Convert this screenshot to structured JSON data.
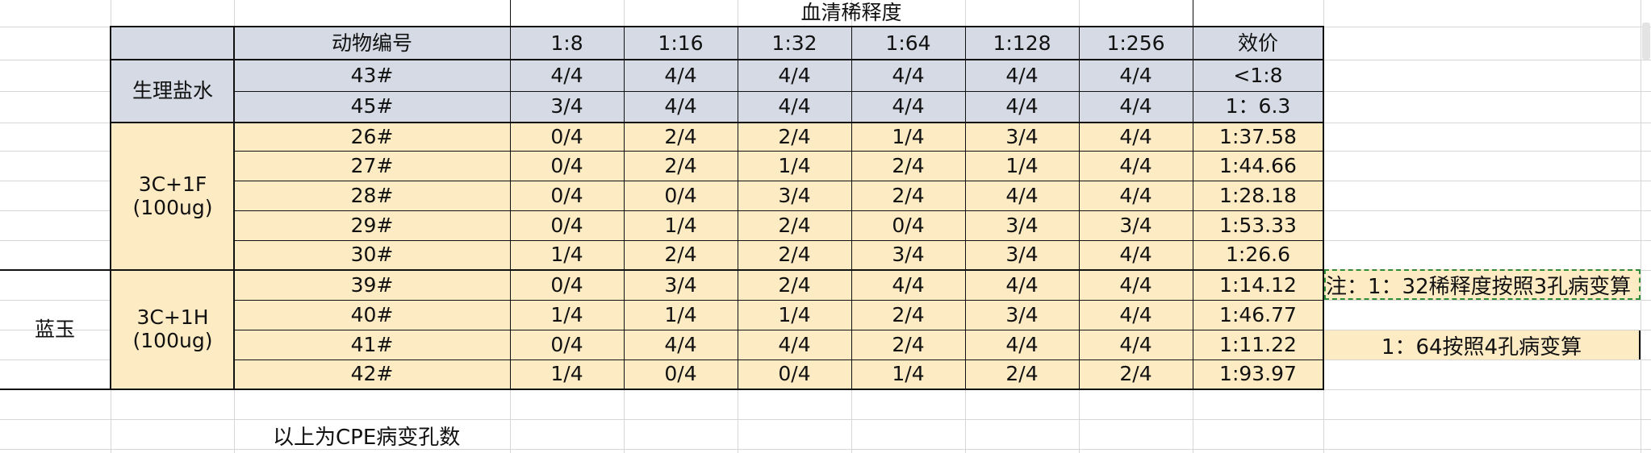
{
  "sheet": {
    "title_dilution": "血清稀释度",
    "headers": [
      "动物编号",
      "1:8",
      "1:16",
      "1:32",
      "1:64",
      "1:128",
      "1:256",
      "效价"
    ],
    "groups": [
      "生理盐水",
      "3C+1F",
      "(100ug)",
      "3C+1H",
      "(100ug)"
    ],
    "outer_label": "蓝玉",
    "rows": [
      [
        "43#",
        "4/4",
        "4/4",
        "4/4",
        "4/4",
        "4/4",
        "4/4",
        "<1:8"
      ],
      [
        "45#",
        "3/4",
        "4/4",
        "4/4",
        "4/4",
        "4/4",
        "4/4",
        "1：6.3"
      ],
      [
        "26#",
        "0/4",
        "2/4",
        "2/4",
        "1/4",
        "3/4",
        "4/4",
        "1:37.58"
      ],
      [
        "27#",
        "0/4",
        "2/4",
        "1/4",
        "2/4",
        "1/4",
        "4/4",
        "1:44.66"
      ],
      [
        "28#",
        "0/4",
        "0/4",
        "3/4",
        "2/4",
        "4/4",
        "4/4",
        "1:28.18"
      ],
      [
        "29#",
        "0/4",
        "1/4",
        "2/4",
        "0/4",
        "3/4",
        "3/4",
        "1:53.33"
      ],
      [
        "30#",
        "1/4",
        "2/4",
        "2/4",
        "3/4",
        "3/4",
        "4/4",
        "1:26.6"
      ],
      [
        "39#",
        "0/4",
        "3/4",
        "2/4",
        "4/4",
        "4/4",
        "4/4",
        "1:14.12"
      ],
      [
        "40#",
        "1/4",
        "1/4",
        "1/4",
        "2/4",
        "3/4",
        "4/4",
        "1:46.77"
      ],
      [
        "41#",
        "0/4",
        "4/4",
        "4/4",
        "2/4",
        "4/4",
        "4/4",
        "1:11.22"
      ],
      [
        "42#",
        "1/4",
        "0/4",
        "0/4",
        "1/4",
        "2/4",
        "2/4",
        "1:93.97"
      ]
    ],
    "note1": "注：1：32稀释度按照3孔病变算",
    "note2": "1：64按照4孔病变算",
    "footer": "以上为CPE病变孔数"
  }
}
